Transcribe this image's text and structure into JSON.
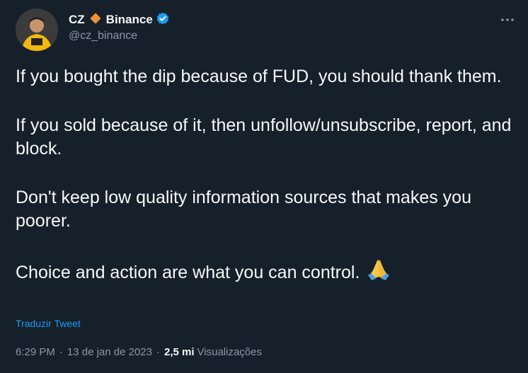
{
  "author": {
    "name": "CZ",
    "brand": "Binance",
    "handle": "@cz_binance"
  },
  "tweet": {
    "paragraphs": [
      "If you bought the dip because of FUD, you should thank them.",
      "If you sold because of it, then unfollow/unsubscribe, report, and block.",
      "Don't keep low quality information sources that makes you poorer.",
      "Choice and action are what you can control."
    ],
    "emoji": "🙏"
  },
  "translate_label": "Traduzir Tweet",
  "meta": {
    "time": "6:29 PM",
    "date": "13 de jan de 2023",
    "separator": "·",
    "views_count": "2,5 mi",
    "views_label": "Visualizações"
  },
  "icons": {
    "brand_diamond": "binance-diamond-icon",
    "verified": "verified-badge-icon",
    "more": "more-options-icon",
    "emoji": "folded-hands-emoji"
  },
  "colors": {
    "background": "#15202b",
    "text_primary": "#f7f9f9",
    "text_secondary": "#8b98a5",
    "link": "#1d9bf0",
    "brand_diamond": "#f0913a",
    "verified": "#1d9bf0"
  }
}
